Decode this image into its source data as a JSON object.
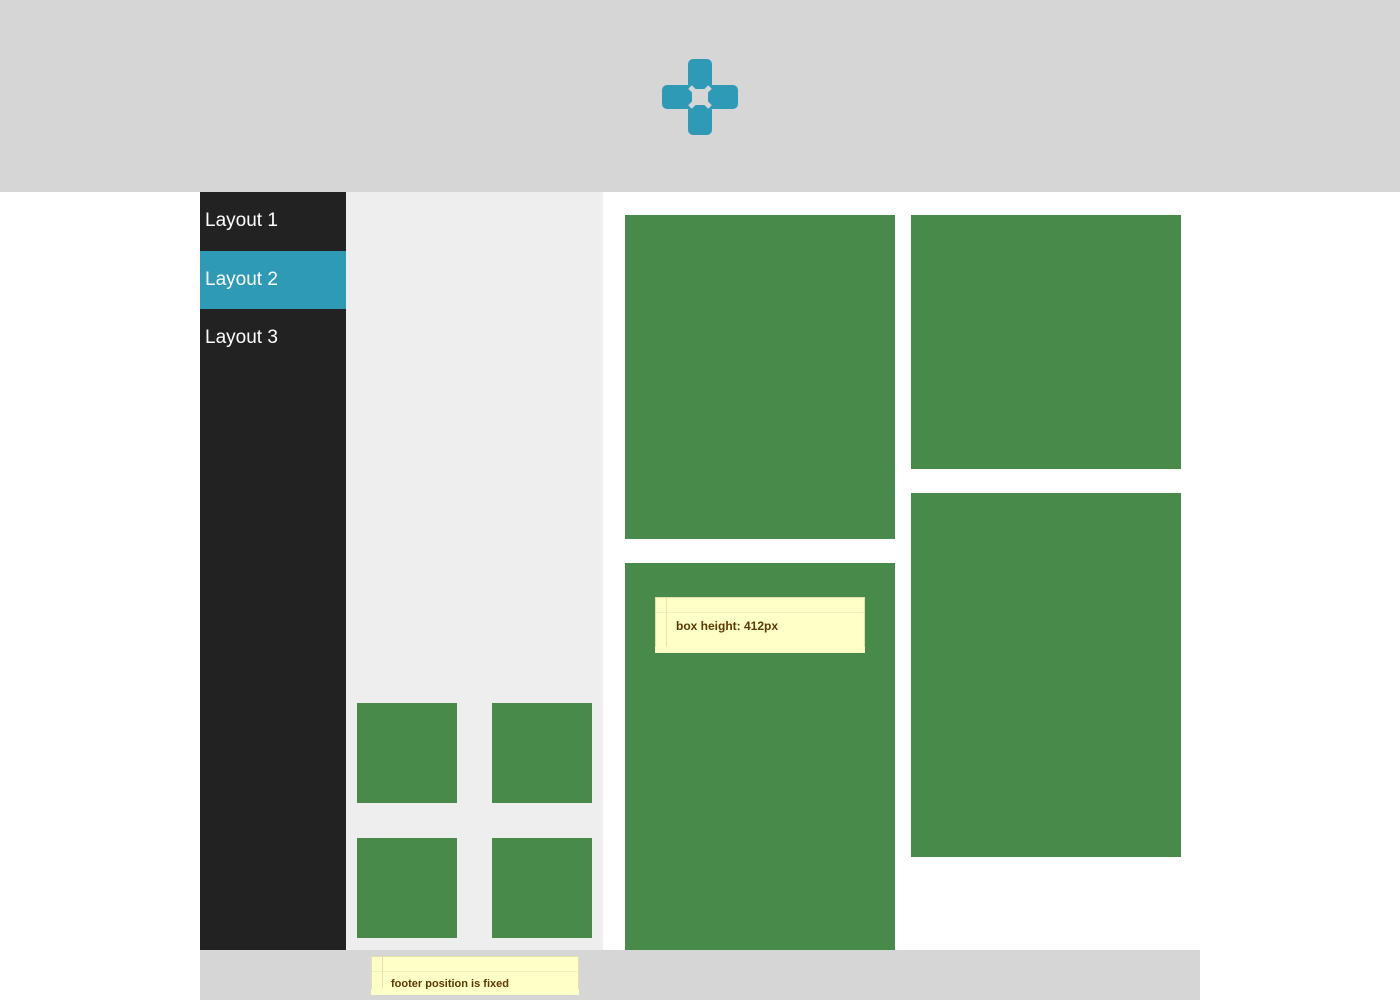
{
  "header": {
    "logo_icon": "gamepad-dpad-icon",
    "logo_color": "#2e9ab6"
  },
  "sidebar": {
    "items": [
      {
        "label": "Layout 1",
        "active": false
      },
      {
        "label": "Layout 2",
        "active": true
      },
      {
        "label": "Layout 3",
        "active": false
      }
    ]
  },
  "main": {
    "note_label": "box height: 412px"
  },
  "footer": {
    "note_label": "footer position is fixed"
  },
  "colors": {
    "header_bg": "#d6d6d6",
    "sidebar_bg": "#222222",
    "active_item": "#2e9ab6",
    "box": "#478a4a",
    "panel_bg": "#eeeeee",
    "note_bg": "#ffffc8"
  }
}
